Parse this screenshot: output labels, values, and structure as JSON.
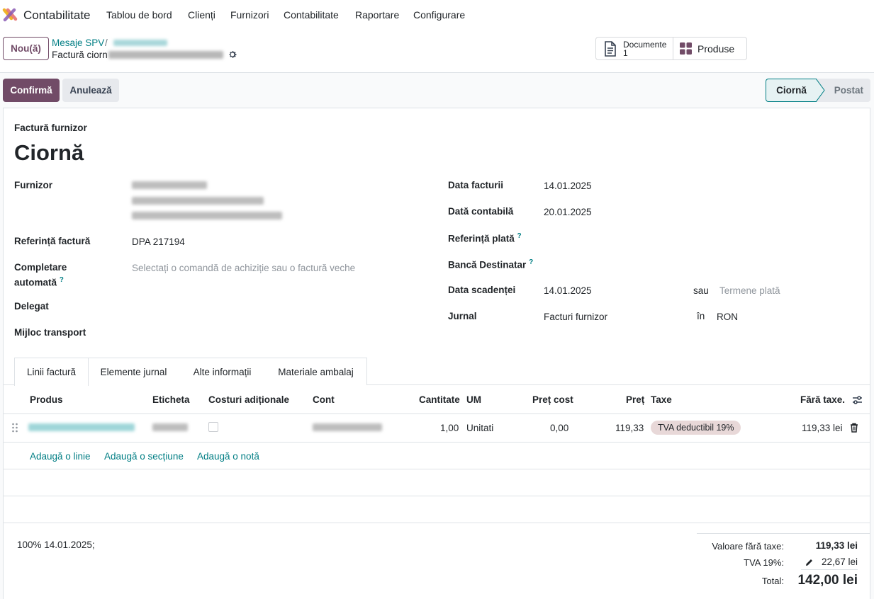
{
  "app": {
    "name": "Contabilitate"
  },
  "menu": [
    "Tablou de bord",
    "Clienți",
    "Furnizori",
    "Contabilitate",
    "Raportare",
    "Configurare"
  ],
  "control_panel": {
    "new_label": "Nou(ă)",
    "breadcrumb_parent": "Mesaje SPV",
    "breadcrumb_sep": "/",
    "breadcrumb_current": "Factură ciorn",
    "smart_documents_label": "Documente",
    "smart_documents_count": "1",
    "smart_products_label": "Produse"
  },
  "actions": {
    "confirm": "Confirmă",
    "cancel": "Anulează"
  },
  "status": {
    "current": "Ciornă",
    "next": "Postat"
  },
  "form": {
    "doc_type": "Factură furnizor",
    "title": "Ciornă",
    "left": {
      "vendor_label": "Furnizor",
      "ref_label": "Referință factură",
      "ref_value": "DPA 217194",
      "autocomplete_label_1": "Completare",
      "autocomplete_label_2": "automată",
      "autocomplete_placeholder": "Selectați o comandă de achiziție sau o factură veche",
      "delegate_label": "Delegat",
      "transport_label": "Mijloc transport",
      "help_mark": "?"
    },
    "right": {
      "invoice_date_label": "Data facturii",
      "invoice_date": "14.01.2025",
      "accounting_date_label": "Dată contabilă",
      "accounting_date": "20.01.2025",
      "payment_ref_label": "Referință plată",
      "bank_label": "Bancă Destinatar",
      "due_date_label": "Data scadenței",
      "due_date": "14.01.2025",
      "or_label": "sau",
      "terms_placeholder": "Termene plată",
      "journal_label": "Jurnal",
      "journal_value": "Facturi furnizor",
      "in_label": "în",
      "currency": "RON"
    }
  },
  "tabs": [
    "Linii factură",
    "Elemente jurnal",
    "Alte informații",
    "Materiale ambalaj"
  ],
  "table": {
    "headers": {
      "product": "Produs",
      "label": "Eticheta",
      "extra_costs": "Costuri adiționale",
      "account": "Cont",
      "quantity": "Cantitate",
      "uom": "UM",
      "cost_price": "Preț cost",
      "price": "Preț",
      "taxes": "Taxe",
      "subtotal": "Fără taxe."
    },
    "row": {
      "quantity": "1,00",
      "uom": "Unitati",
      "cost_price": "0,00",
      "price": "119,33",
      "tax": "TVA deductibil 19%",
      "subtotal": "119,33 lei"
    },
    "add_line": "Adaugă o linie",
    "add_section": "Adaugă o secțiune",
    "add_note": "Adaugă o notă"
  },
  "footer": {
    "payment_terms_note": "100% 14.01.2025;",
    "untaxed_label": "Valoare fără taxe:",
    "untaxed_value": "119,33 lei",
    "tax_label": "TVA 19%:",
    "tax_value": "22,67 lei",
    "total_label": "Total:",
    "total_value": "142,00 lei"
  },
  "colors": {
    "primary": "#714b67",
    "link": "#017e84"
  }
}
